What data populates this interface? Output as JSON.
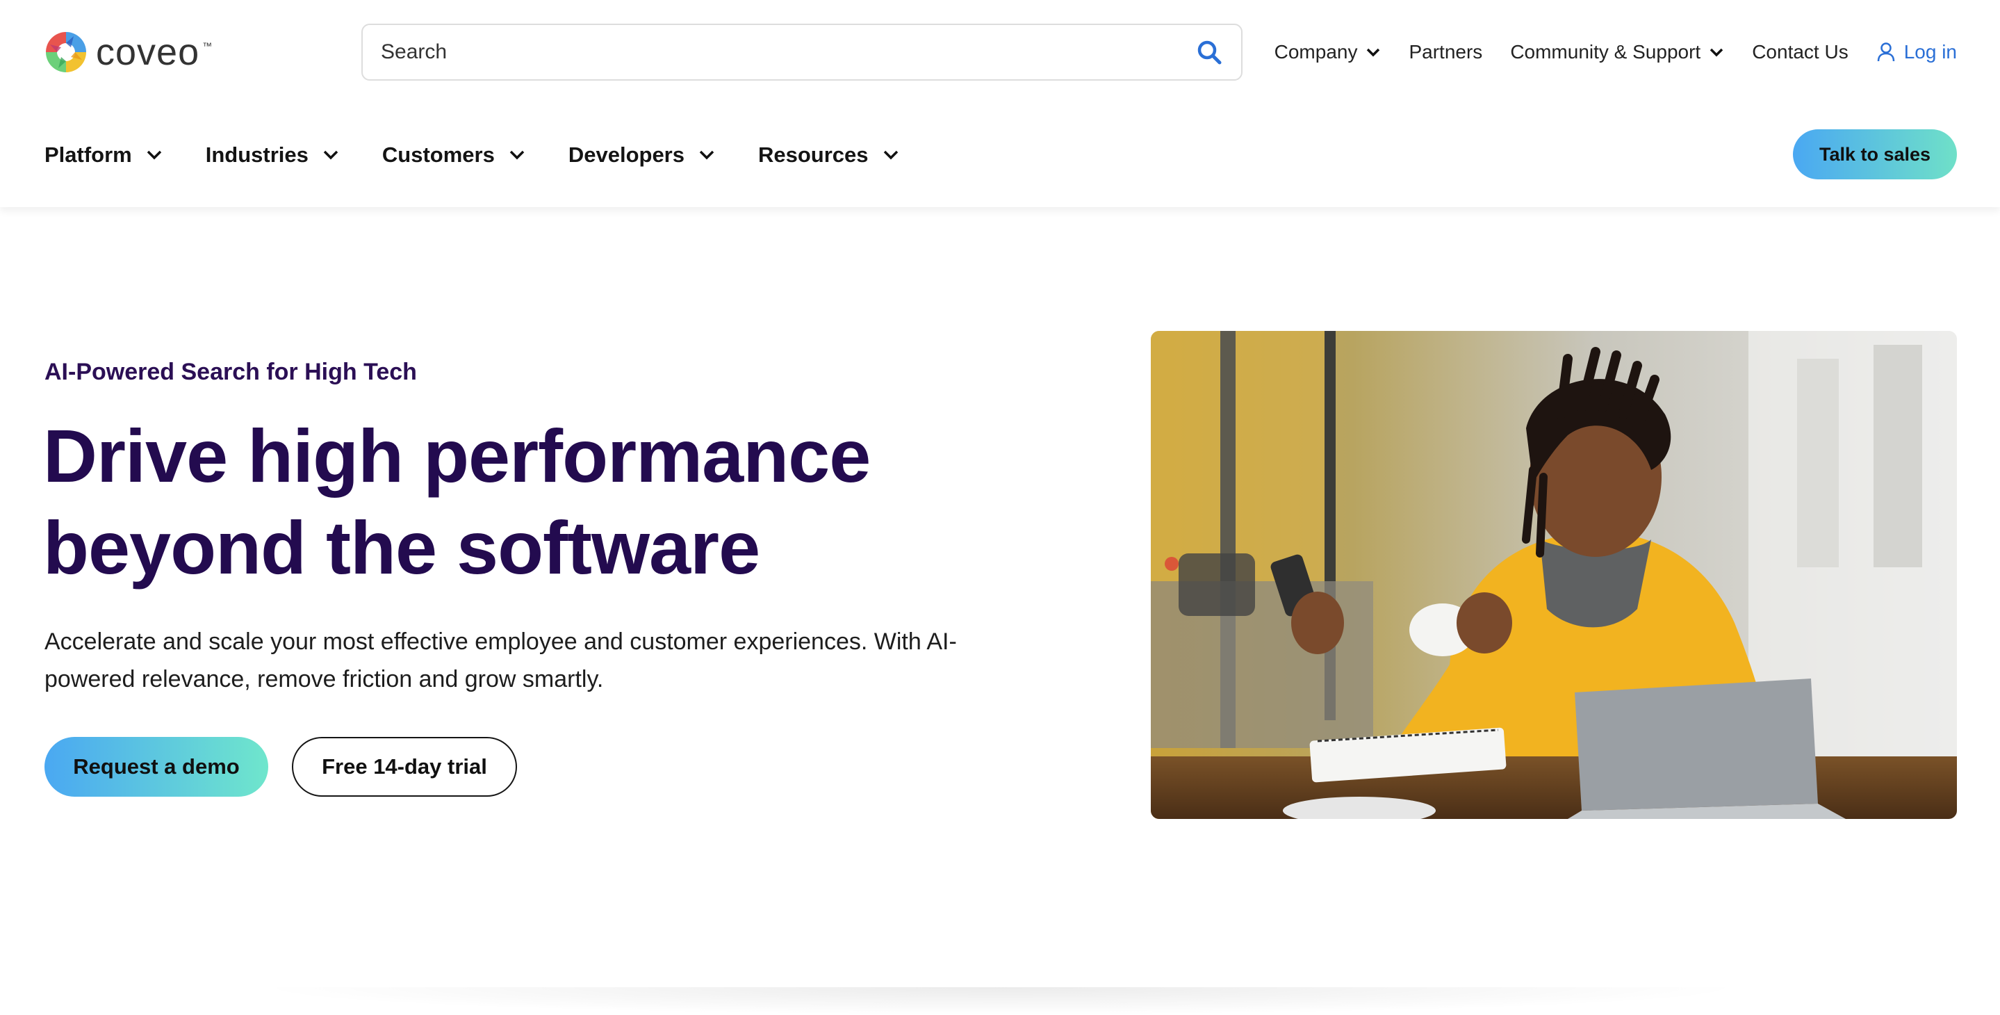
{
  "header": {
    "logo_text": "coveo",
    "logo_tm": "™",
    "search": {
      "placeholder": "Search"
    },
    "utility_nav": [
      {
        "label": "Company",
        "has_dropdown": true
      },
      {
        "label": "Partners",
        "has_dropdown": false
      },
      {
        "label": "Community & Support",
        "has_dropdown": true
      },
      {
        "label": "Contact Us",
        "has_dropdown": false
      },
      {
        "label": "Log in",
        "icon": "user-icon"
      }
    ],
    "main_nav": [
      {
        "label": "Platform"
      },
      {
        "label": "Industries"
      },
      {
        "label": "Customers"
      },
      {
        "label": "Developers"
      },
      {
        "label": "Resources"
      }
    ],
    "cta_label": "Talk to sales"
  },
  "hero": {
    "eyebrow": "AI-Powered Search for High Tech",
    "title_line1": "Drive high performance",
    "title_line2": "beyond the software",
    "description": "Accelerate and scale your most effective employee and customer experiences. With AI-powered relevance, remove friction and grow smartly.",
    "primary_button": "Request a demo",
    "secondary_button": "Free 14-day trial",
    "image_icon": "photo-man-with-phone-and-laptop"
  },
  "colors": {
    "brand_dark": "#230b4f",
    "gradient_start": "#4aa8f2",
    "gradient_end": "#6fe0c8",
    "link_blue": "#2a6fd6"
  }
}
